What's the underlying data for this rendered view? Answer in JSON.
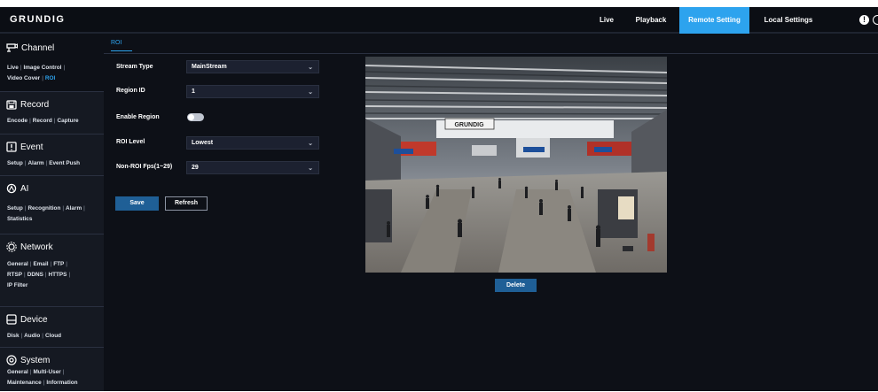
{
  "header": {
    "logo": "GRUNDIG",
    "nav": [
      {
        "label": "Live",
        "active": false
      },
      {
        "label": "Playback",
        "active": false
      },
      {
        "label": "Remote Setting",
        "active": true
      },
      {
        "label": "Local Settings",
        "active": false
      }
    ],
    "info_icon": "!"
  },
  "sidebar": {
    "channel": {
      "title": "Channel",
      "icon": "camera-icon",
      "links": [
        "Live",
        "Image Control",
        "Video Cover",
        "ROI"
      ],
      "active": "ROI"
    },
    "record": {
      "title": "Record",
      "icon": "record-icon",
      "links": [
        "Encode",
        "Record",
        "Capture"
      ]
    },
    "event": {
      "title": "Event",
      "icon": "event-icon",
      "links": [
        "Setup",
        "Alarm",
        "Event Push"
      ]
    },
    "ai": {
      "title": "AI",
      "icon": "ai-icon",
      "links": [
        "Setup",
        "Recognition",
        "Alarm",
        "Statistics"
      ]
    },
    "network": {
      "title": "Network",
      "icon": "network-icon",
      "links": [
        "General",
        "Email",
        "FTP",
        "RTSP",
        "DDNS",
        "HTTPS",
        "IP Filter"
      ]
    },
    "device": {
      "title": "Device",
      "icon": "device-icon",
      "links": [
        "Disk",
        "Audio",
        "Cloud"
      ]
    },
    "system": {
      "title": "System",
      "icon": "system-icon",
      "links": [
        "General",
        "Multi-User",
        "Maintenance",
        "Information"
      ]
    }
  },
  "tab": {
    "label": "ROI"
  },
  "form": {
    "stream_type": {
      "label": "Stream Type",
      "value": "MainStream"
    },
    "region_id": {
      "label": "Region ID",
      "value": "1"
    },
    "enable_region": {
      "label": "Enable Region",
      "enabled": false
    },
    "roi_level": {
      "label": "ROI Level",
      "value": "Lowest"
    },
    "non_roi_fps": {
      "label": "Non-ROI Fps(1~29)",
      "value": "29"
    },
    "save_label": "Save",
    "refresh_label": "Refresh"
  },
  "preview": {
    "sign_text": "GRUNDIG",
    "delete_label": "Delete"
  },
  "colors": {
    "accent": "#2da3ee",
    "button": "#1f5f96",
    "background": "#0d1017",
    "sidebar": "#151922"
  }
}
